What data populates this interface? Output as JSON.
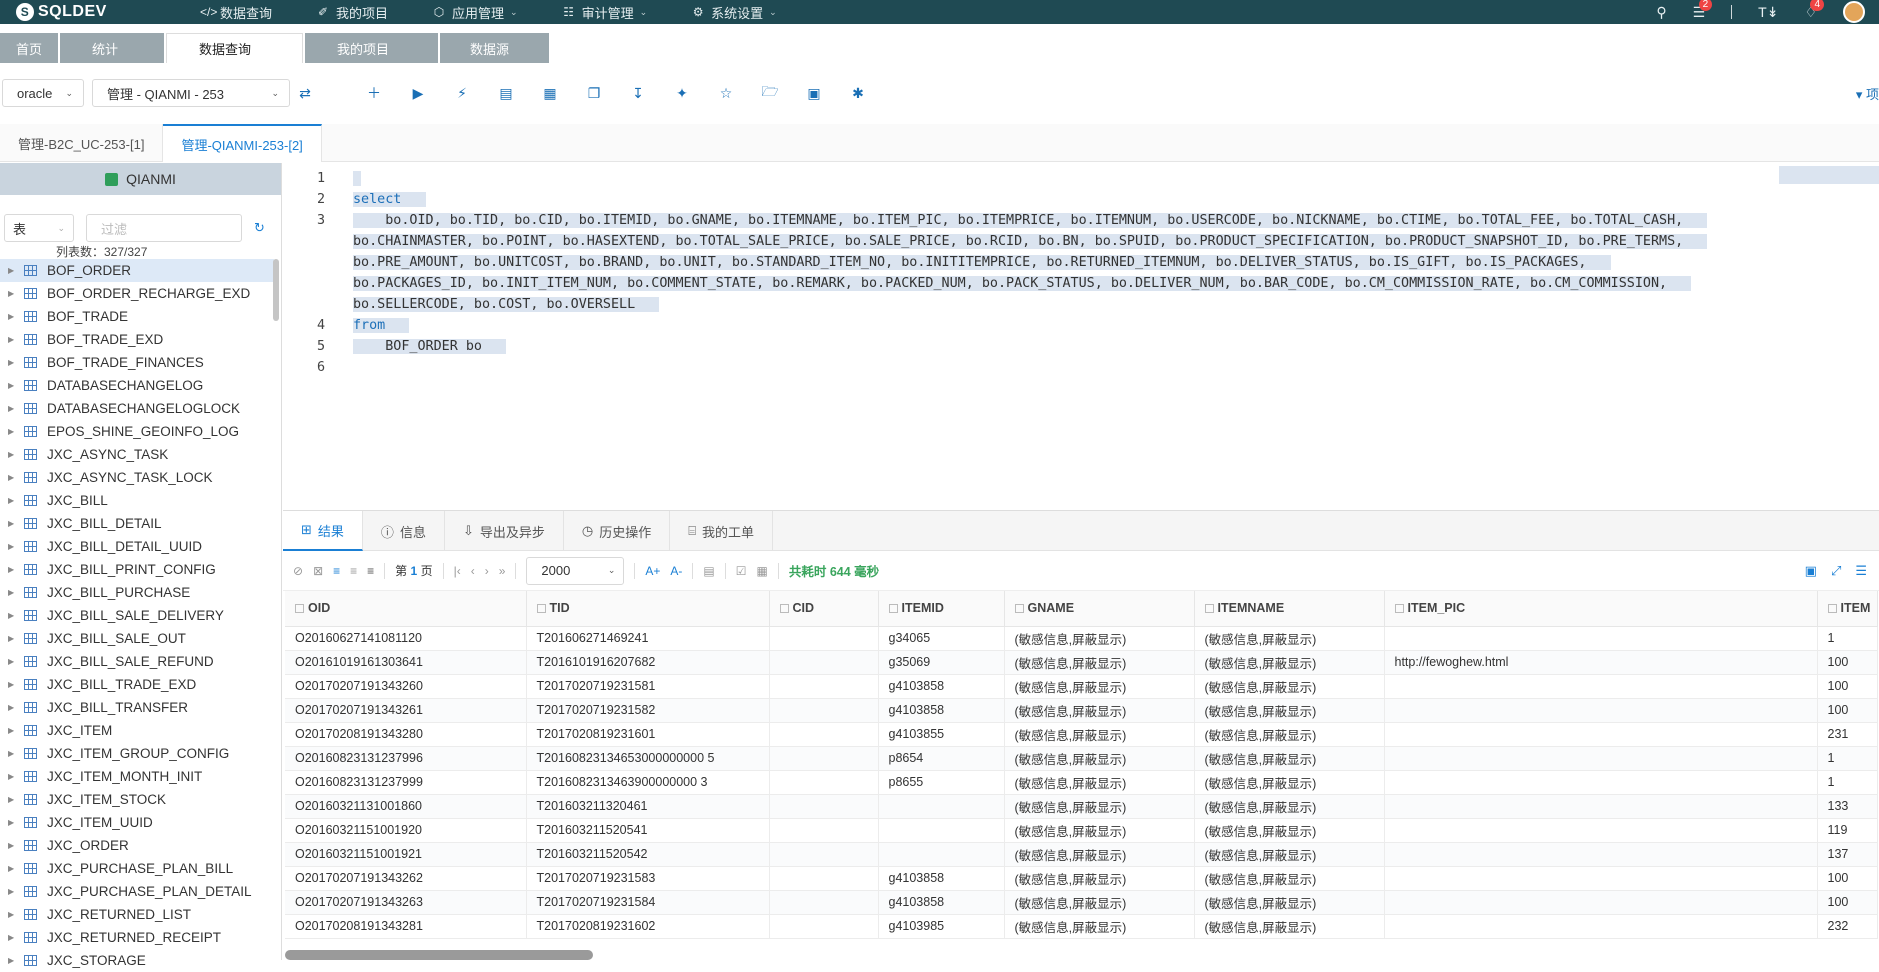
{
  "app": {
    "logo": "SQLDEV"
  },
  "nav": [
    {
      "icon": "code-icon",
      "label": "数据查询",
      "caret": false
    },
    {
      "icon": "doc-icon",
      "label": "我的项目",
      "caret": false
    },
    {
      "icon": "cube-icon",
      "label": "应用管理",
      "caret": true
    },
    {
      "icon": "audit-icon",
      "label": "审计管理",
      "caret": true
    },
    {
      "icon": "gear-icon",
      "label": "系统设置",
      "caret": true
    }
  ],
  "top_right": {
    "badge1": "2",
    "badge2": "4"
  },
  "module_tabs": [
    "首页",
    "统计",
    "数据查询",
    "我的项目",
    "数据源"
  ],
  "module_active": 2,
  "toolbar": {
    "db_type": "oracle",
    "connection": "管理 - QIANMI - 253"
  },
  "editor_tabs": [
    "管理-B2C_UC-253-[1]",
    "管理-QIANMI-253-[2]"
  ],
  "editor_active": 1,
  "left": {
    "schema": "QIANMI",
    "filter_type": "表",
    "filter_placeholder": "过滤",
    "count_text": "列表数：327/327",
    "tables": [
      "BOF_ORDER",
      "BOF_ORDER_RECHARGE_EXD",
      "BOF_TRADE",
      "BOF_TRADE_EXD",
      "BOF_TRADE_FINANCES",
      "DATABASECHANGELOG",
      "DATABASECHANGELOGLOCK",
      "EPOS_SHINE_GEOINFO_LOG",
      "JXC_ASYNC_TASK",
      "JXC_ASYNC_TASK_LOCK",
      "JXC_BILL",
      "JXC_BILL_DETAIL",
      "JXC_BILL_DETAIL_UUID",
      "JXC_BILL_PRINT_CONFIG",
      "JXC_BILL_PURCHASE",
      "JXC_BILL_SALE_DELIVERY",
      "JXC_BILL_SALE_OUT",
      "JXC_BILL_SALE_REFUND",
      "JXC_BILL_TRADE_EXD",
      "JXC_BILL_TRANSFER",
      "JXC_ITEM",
      "JXC_ITEM_GROUP_CONFIG",
      "JXC_ITEM_MONTH_INIT",
      "JXC_ITEM_STOCK",
      "JXC_ITEM_UUID",
      "JXC_ORDER",
      "JXC_PURCHASE_PLAN_BILL",
      "JXC_PURCHASE_PLAN_DETAIL",
      "JXC_RETURNED_LIST",
      "JXC_RETURNED_RECEIPT",
      "JXC_STORAGE"
    ]
  },
  "editor": {
    "line_numbers": [
      "1",
      "2",
      "3",
      "4",
      "5",
      "6"
    ],
    "lines": [
      "",
      "select",
      "    bo.OID, bo.TID, bo.CID, bo.ITEMID, bo.GNAME, bo.ITEMNAME, bo.ITEM_PIC, bo.ITEMPRICE, bo.ITEMNUM, bo.USERCODE, bo.NICKNAME, bo.CTIME, bo.TOTAL_FEE, bo.TOTAL_CASH,",
      "bo.CHAINMASTER, bo.POINT, bo.HASEXTEND, bo.TOTAL_SALE_PRICE, bo.SALE_PRICE, bo.RCID, bo.BN, bo.SPUID, bo.PRODUCT_SPECIFICATION, bo.PRODUCT_SNAPSHOT_ID, bo.PRE_TERMS,",
      "bo.PRE_AMOUNT, bo.UNITCOST, bo.BRAND, bo.UNIT, bo.STANDARD_ITEM_NO, bo.INITITEMPRICE, bo.RETURNED_ITEMNUM, bo.DELIVER_STATUS, bo.IS_GIFT, bo.IS_PACKAGES,",
      "bo.PACKAGES_ID, bo.INIT_ITEM_NUM, bo.COMMENT_STATE, bo.REMARK, bo.PACKED_NUM, bo.PACK_STATUS, bo.DELIVER_NUM, bo.BAR_CODE, bo.CM_COMMISSION_RATE, bo.CM_COMMISSION,",
      "bo.SELLERCODE, bo.COST, bo.OVERSELL",
      "from",
      "    BOF_ORDER bo",
      ""
    ]
  },
  "results": {
    "tabs": [
      {
        "icon": "grid-icon",
        "label": "结果"
      },
      {
        "icon": "info-icon",
        "label": "信息"
      },
      {
        "icon": "export-icon",
        "label": "导出及异步"
      },
      {
        "icon": "history-icon",
        "label": "历史操作"
      },
      {
        "icon": "ticket-icon",
        "label": "我的工单"
      }
    ],
    "page_prefix": "第",
    "page_num": "1",
    "page_suffix": "页",
    "limit": "2000",
    "elapsed": "共耗时 644 毫秒",
    "columns": [
      "OID",
      "TID",
      "CID",
      "ITEMID",
      "GNAME",
      "ITEMNAME",
      "ITEM_PIC",
      "ITEM"
    ],
    "rows": [
      [
        "O20160627141081120",
        "T201606271469241",
        "",
        "g34065",
        "(敏感信息,屏蔽显示)",
        "(敏感信息,屏蔽显示)",
        "",
        "1"
      ],
      [
        "O20161019161303641",
        "T2016101916207682",
        "",
        "g35069",
        "(敏感信息,屏蔽显示)",
        "(敏感信息,屏蔽显示)",
        "http://fewoghew.html",
        "100"
      ],
      [
        "O20170207191343260",
        "T2017020719231581",
        "",
        "g4103858",
        "(敏感信息,屏蔽显示)",
        "(敏感信息,屏蔽显示)",
        "",
        "100"
      ],
      [
        "O20170207191343261",
        "T2017020719231582",
        "",
        "g4103858",
        "(敏感信息,屏蔽显示)",
        "(敏感信息,屏蔽显示)",
        "",
        "100"
      ],
      [
        "O20170208191343280",
        "T2017020819231601",
        "",
        "g4103855",
        "(敏感信息,屏蔽显示)",
        "(敏感信息,屏蔽显示)",
        "",
        "231"
      ],
      [
        "O20160823131237996",
        "T20160823134653000000000 5",
        "",
        "p8654",
        "(敏感信息,屏蔽显示)",
        "(敏感信息,屏蔽显示)",
        "",
        "1"
      ],
      [
        "O20160823131237999",
        "T2016082313463900000000 3",
        "",
        "p8655",
        "(敏感信息,屏蔽显示)",
        "(敏感信息,屏蔽显示)",
        "",
        "1"
      ],
      [
        "O20160321131001860",
        "T201603211320461",
        "",
        "",
        "(敏感信息,屏蔽显示)",
        "(敏感信息,屏蔽显示)",
        "",
        "133"
      ],
      [
        "O20160321151001920",
        "T201603211520541",
        "",
        "",
        "(敏感信息,屏蔽显示)",
        "(敏感信息,屏蔽显示)",
        "",
        "119"
      ],
      [
        "O20160321151001921",
        "T201603211520542",
        "",
        "",
        "(敏感信息,屏蔽显示)",
        "(敏感信息,屏蔽显示)",
        "",
        "137"
      ],
      [
        "O20170207191343262",
        "T2017020719231583",
        "",
        "g4103858",
        "(敏感信息,屏蔽显示)",
        "(敏感信息,屏蔽显示)",
        "",
        "100"
      ],
      [
        "O20170207191343263",
        "T2017020719231584",
        "",
        "g4103858",
        "(敏感信息,屏蔽显示)",
        "(敏感信息,屏蔽显示)",
        "",
        "100"
      ],
      [
        "O20170208191343281",
        "T2017020819231602",
        "",
        "g4103985",
        "(敏感信息,屏蔽显示)",
        "(敏感信息,屏蔽显示)",
        "",
        "232"
      ]
    ]
  }
}
